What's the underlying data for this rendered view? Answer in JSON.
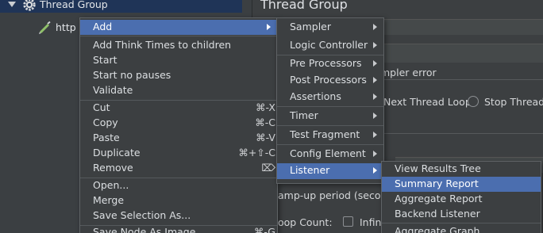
{
  "tree": {
    "thread_group_label": "Thread Group",
    "http_item_label": "http E"
  },
  "right_panel": {
    "title": "Thread Group",
    "sampler_error_label": "mpler error",
    "next_thread_loop_label": "Next Thread Loop",
    "stop_thread_label": "Stop Thread",
    "ramp_up_label": "amp-up period (seconds",
    "loop_count_label": "oop Count:",
    "infinite_label": "Infini"
  },
  "context_menu": {
    "items": [
      {
        "label": "Add",
        "shortcut": "",
        "submenu": true,
        "highlighted": true
      },
      {
        "label": "Add Think Times to children",
        "shortcut": ""
      },
      {
        "label": "Start",
        "shortcut": ""
      },
      {
        "label": "Start no pauses",
        "shortcut": ""
      },
      {
        "label": "Validate",
        "shortcut": ""
      },
      {
        "label": "Cut",
        "shortcut": "⌘-X"
      },
      {
        "label": "Copy",
        "shortcut": "⌘-C"
      },
      {
        "label": "Paste",
        "shortcut": "⌘-V"
      },
      {
        "label": "Duplicate",
        "shortcut": "⌘+⇧-C"
      },
      {
        "label": "Remove",
        "shortcut": "⌦"
      },
      {
        "label": "Open...",
        "shortcut": ""
      },
      {
        "label": "Merge",
        "shortcut": ""
      },
      {
        "label": "Save Selection As...",
        "shortcut": ""
      },
      {
        "label": "Save Node As Image",
        "shortcut": "⌘-G"
      }
    ]
  },
  "add_submenu": {
    "items": [
      {
        "label": "Sampler"
      },
      {
        "label": "Logic Controller"
      },
      {
        "label": "Pre Processors"
      },
      {
        "label": "Post Processors"
      },
      {
        "label": "Assertions"
      },
      {
        "label": "Timer"
      },
      {
        "label": "Test Fragment"
      },
      {
        "label": "Config Element"
      },
      {
        "label": "Listener",
        "highlighted": true
      }
    ]
  },
  "listener_submenu": {
    "items": [
      {
        "label": "View Results Tree"
      },
      {
        "label": "Summary Report",
        "highlighted": true
      },
      {
        "label": "Aggregate Report"
      },
      {
        "label": "Backend Listener"
      },
      {
        "label": "Aggregate Graph"
      }
    ]
  },
  "colors": {
    "menu_highlight": "#4b6eaf",
    "selection_row": "#1f3457",
    "panel_bg": "#3c3f41"
  }
}
